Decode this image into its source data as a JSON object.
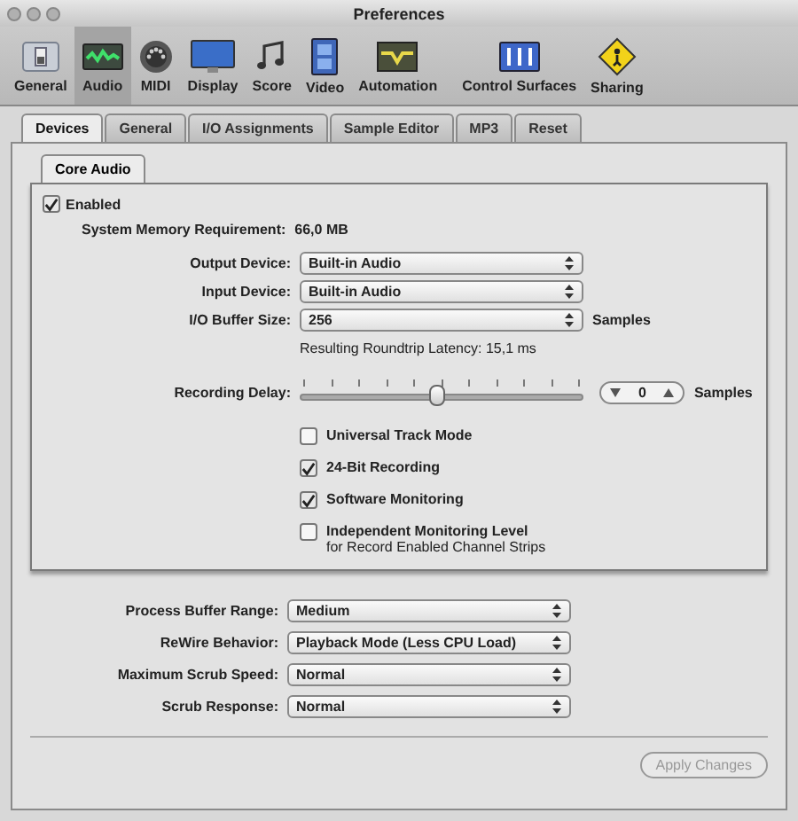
{
  "window": {
    "title": "Preferences"
  },
  "toolbar": [
    {
      "label": "General",
      "kind": "switch",
      "selected": false
    },
    {
      "label": "Audio",
      "kind": "audio",
      "selected": true
    },
    {
      "label": "MIDI",
      "kind": "midi",
      "selected": false
    },
    {
      "label": "Display",
      "kind": "display",
      "selected": false
    },
    {
      "label": "Score",
      "kind": "score",
      "selected": false
    },
    {
      "label": "Video",
      "kind": "video",
      "selected": false
    },
    {
      "label": "Automation",
      "kind": "automation",
      "selected": false
    },
    {
      "label": "Control Surfaces",
      "kind": "surface",
      "selected": false
    },
    {
      "label": "Sharing",
      "kind": "sharing",
      "selected": false
    }
  ],
  "tabs": [
    {
      "label": "Devices",
      "selected": true
    },
    {
      "label": "General",
      "selected": false
    },
    {
      "label": "I/O Assignments",
      "selected": false
    },
    {
      "label": "Sample Editor",
      "selected": false
    },
    {
      "label": "MP3",
      "selected": false
    },
    {
      "label": "Reset",
      "selected": false
    }
  ],
  "core_audio": {
    "tab": "Core Audio",
    "enabled": {
      "label": "Enabled",
      "checked": true
    },
    "memory": {
      "label": "System Memory Requirement:",
      "value": "66,0 MB"
    },
    "fields": [
      {
        "label": "Output Device:",
        "value": "Built-in Audio"
      },
      {
        "label": "Input Device:",
        "value": "Built-in Audio"
      },
      {
        "label": "I/O Buffer Size:",
        "value": "256",
        "suffix": "Samples"
      }
    ],
    "latency": "Resulting Roundtrip Latency: 15,1 ms",
    "recording_delay": {
      "label": "Recording Delay:",
      "level": 0.49,
      "value": "0",
      "suffix": "Samples"
    },
    "options": [
      {
        "label": "Universal Track Mode",
        "checked": false
      },
      {
        "label": "24-Bit Recording",
        "checked": true
      },
      {
        "label": "Software Monitoring",
        "checked": true
      },
      {
        "label": "Independent Monitoring Level",
        "note": "for Record Enabled Channel Strips",
        "checked": false
      }
    ]
  },
  "fields": [
    {
      "label": "Process Buffer Range:",
      "value": "Medium"
    },
    {
      "label": "ReWire Behavior:",
      "value": "Playback Mode (Less CPU Load)"
    },
    {
      "label": "Maximum Scrub Speed:",
      "value": "Normal"
    },
    {
      "label": "Scrub Response:",
      "value": "Normal"
    }
  ],
  "apply_button": {
    "label": "Apply Changes",
    "disabled": true
  }
}
